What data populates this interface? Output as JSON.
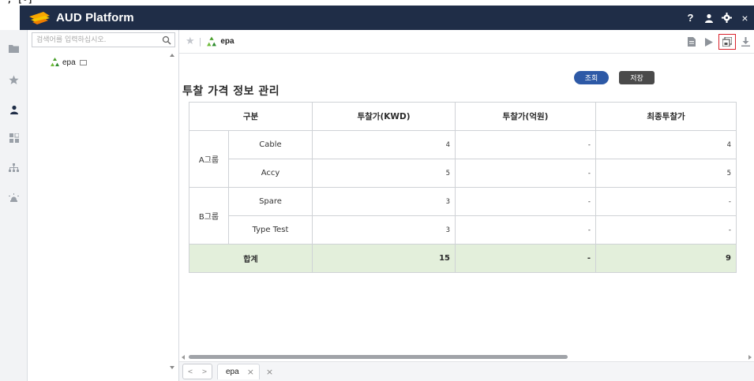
{
  "app": {
    "title": "AUD Platform",
    "corner_glyph": "*, [•]"
  },
  "topbar": {
    "help_label": "?",
    "icons": [
      "user-icon",
      "gear-icon",
      "close-icon"
    ],
    "close_label": "×"
  },
  "leftnav": {
    "items": [
      "folder-icon",
      "star-icon",
      "user-icon",
      "grid-icon",
      "hierarchy-icon",
      "alarm-icon"
    ],
    "active_index": 2
  },
  "tree": {
    "search_placeholder": "검색어를 입력하십시오.",
    "nodes": [
      {
        "label": "epa"
      }
    ]
  },
  "breadcrumb": {
    "label": "epa"
  },
  "toolbar": {
    "icons": [
      "document-icon",
      "run-icon",
      "save-as-icon",
      "download-icon"
    ],
    "active_icon": "save-as-icon"
  },
  "page": {
    "title": "투찰 가격 정보 관리",
    "btn_query": "조회",
    "btn_save": "저장"
  },
  "table": {
    "headers": [
      "구분",
      "투찰가(KWD)",
      "투찰가(억원)",
      "최종투찰가"
    ],
    "groups": [
      {
        "name": "A그룹",
        "rows": [
          {
            "item": "Cable",
            "kwd": "4",
            "eok": "-",
            "final": "4"
          },
          {
            "item": "Accy",
            "kwd": "5",
            "eok": "-",
            "final": "5"
          }
        ]
      },
      {
        "name": "B그룹",
        "rows": [
          {
            "item": "Spare",
            "kwd": "3",
            "eok": "-",
            "final": "-"
          },
          {
            "item": "Type Test",
            "kwd": "3",
            "eok": "-",
            "final": "-"
          }
        ]
      }
    ],
    "total": {
      "label": "합계",
      "kwd": "15",
      "eok": "-",
      "final": "9"
    }
  },
  "bottombar": {
    "nav_prev": "<",
    "nav_next": ">",
    "tab_label": "epa",
    "tab_close": "×",
    "close_all": "×"
  },
  "colors": {
    "topbar": "#1f2d47",
    "query_button": "#2d59a6",
    "save_button": "#4a4a4a",
    "total_row": "#e3efdb",
    "active_outline": "#d9232d"
  }
}
